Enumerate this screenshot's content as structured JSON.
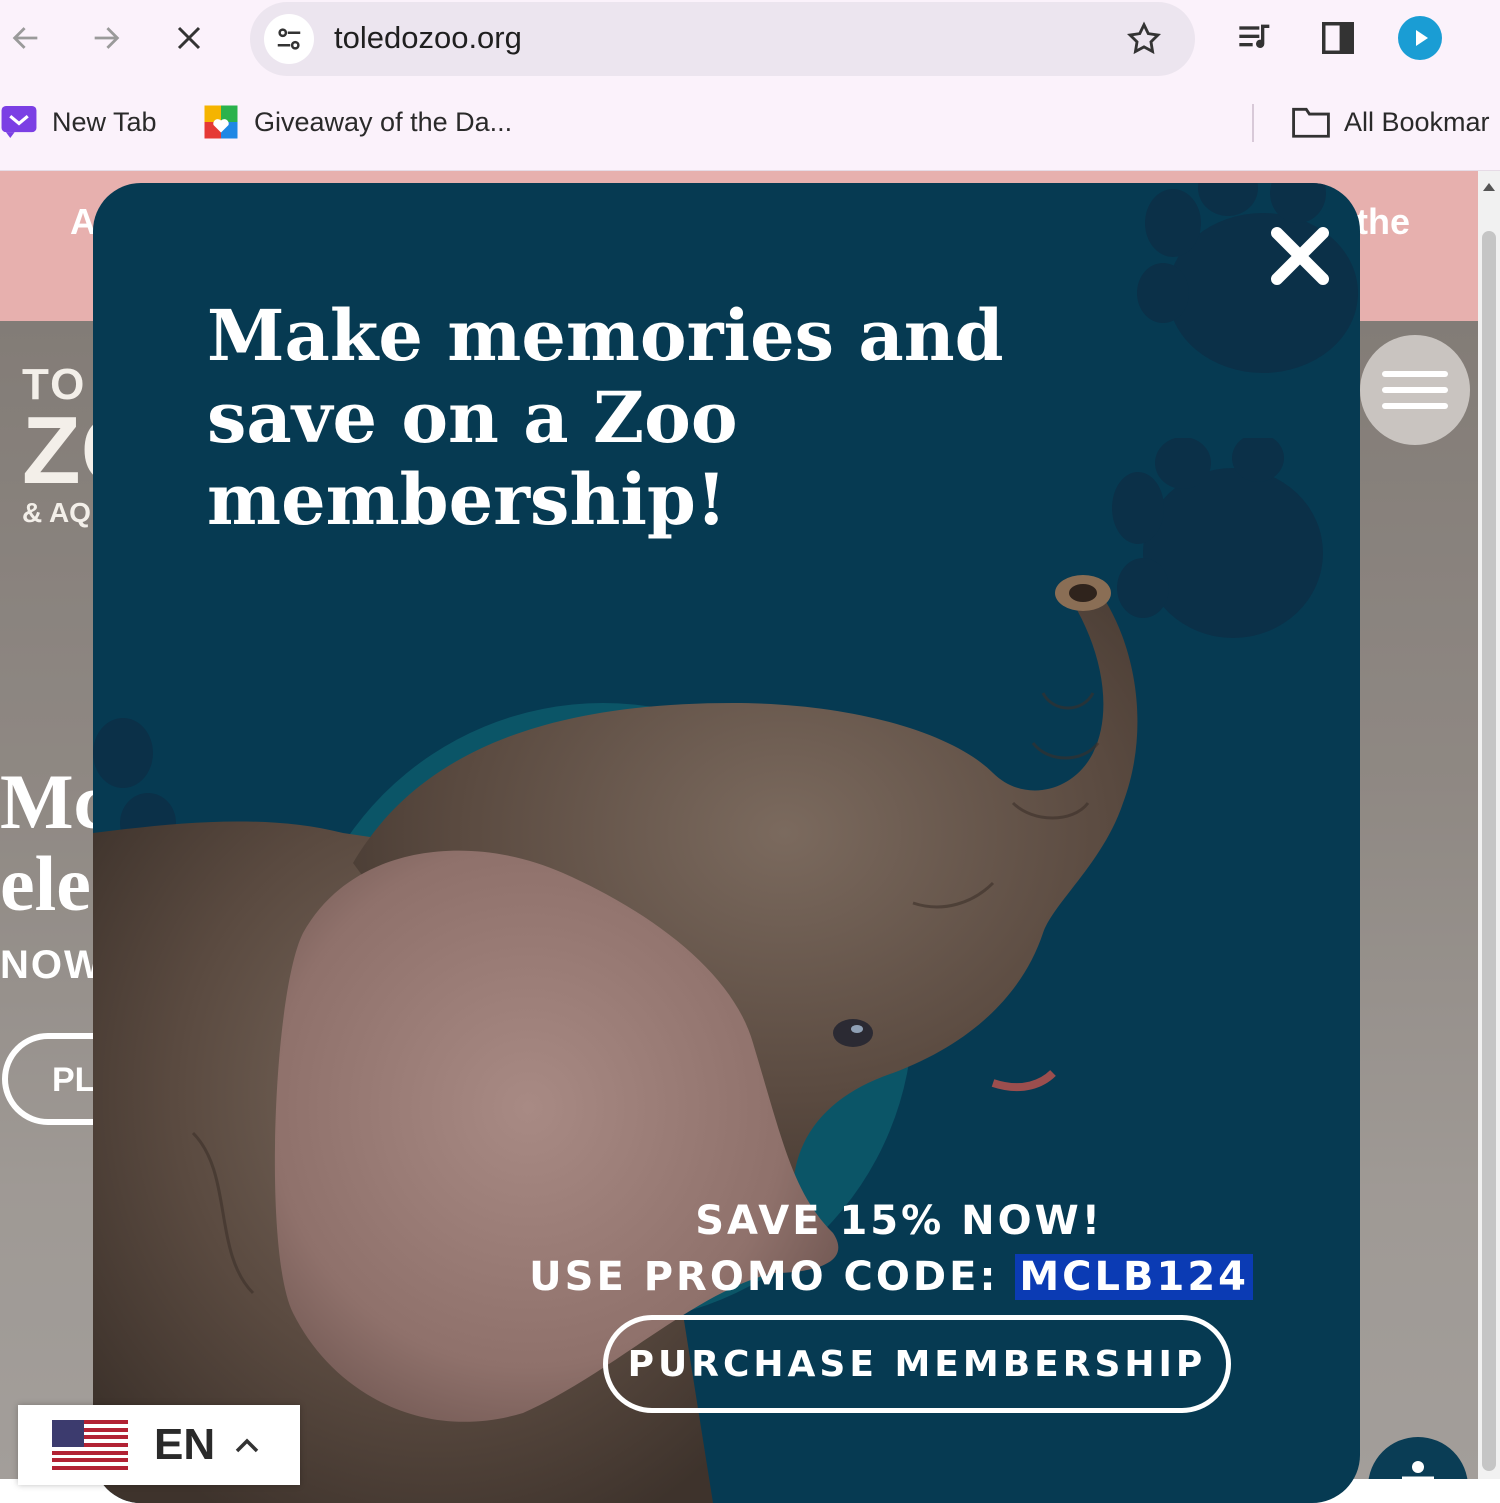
{
  "browser": {
    "url": "toledozoo.org",
    "bookmarks": [
      {
        "label": "New Tab",
        "icon": "new-tab-icon"
      },
      {
        "label": "Giveaway of the Da...",
        "icon": "giveaway-icon"
      }
    ],
    "all_bookmarks_label": "All Bookmar"
  },
  "page": {
    "alert_left": "A",
    "alert_right": "the",
    "logo_line1": "TO",
    "logo_line2": "ZC",
    "logo_line3": "& AQ",
    "hero_title_line1": "Mc",
    "hero_title_line2": "ele",
    "hero_sub": "NOW",
    "hero_button": "PL"
  },
  "modal": {
    "title": "Make memories and save on a Zoo membership!",
    "promo_line1": "SAVE 15% NOW!",
    "promo_prefix": "USE PROMO CODE: ",
    "promo_code": "MCLB124",
    "purchase_label": "PURCHASE MEMBERSHIP"
  },
  "language": {
    "code": "EN",
    "flag": "us-flag-icon"
  },
  "colors": {
    "modal_bg": "#063a52",
    "alert_strip": "#e7b0ae",
    "promo_highlight": "#0b3bb4",
    "paw": "#0b3048",
    "teal_circle": "#0b5567"
  }
}
